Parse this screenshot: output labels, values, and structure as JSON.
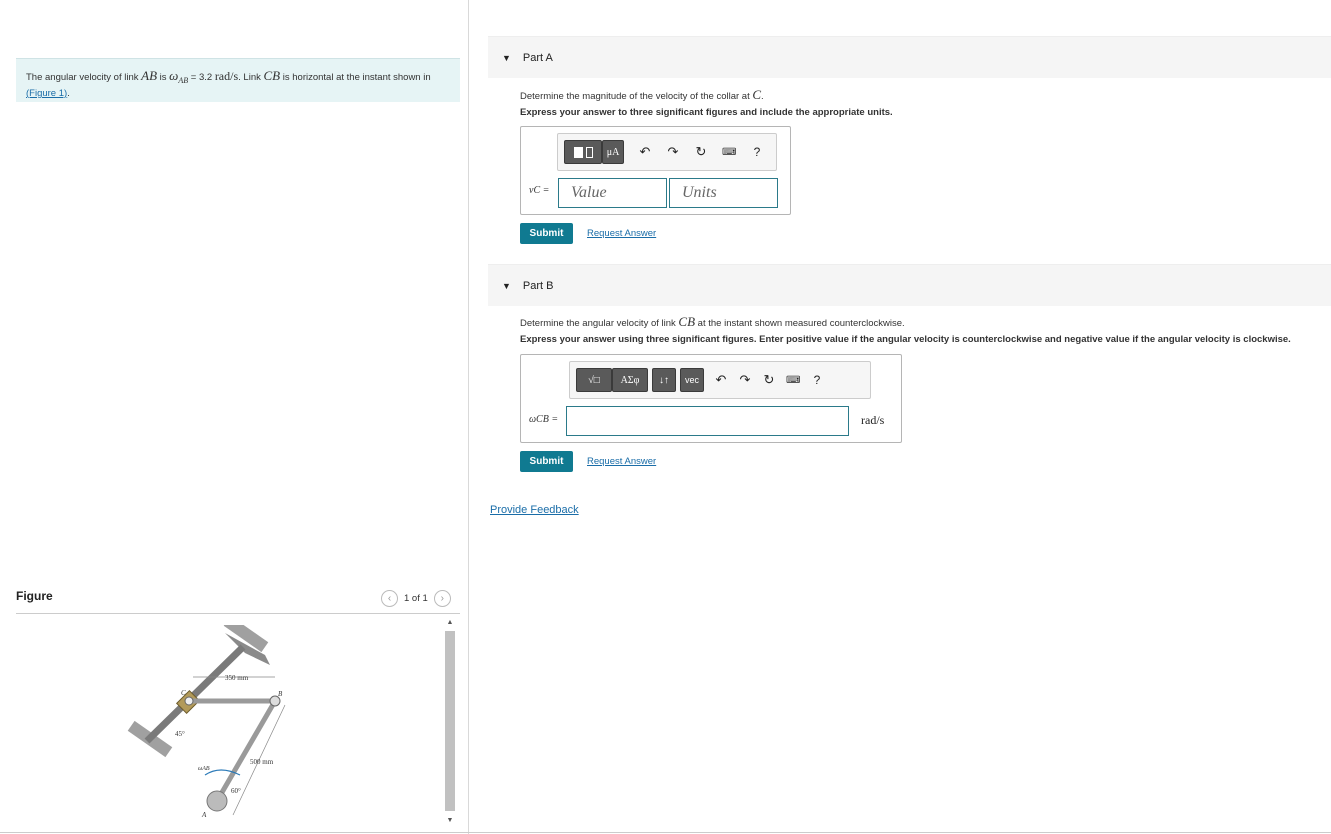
{
  "problem": {
    "text_1": "The angular velocity of link ",
    "AB": "AB",
    "text_2": " is ",
    "omega_ab": "ω",
    "omega_ab_sub": "AB",
    "text_3": " = 3.2 ",
    "rad_s": "rad/s",
    "text_4": ". Link ",
    "CB": "CB",
    "text_5": " is horizontal at the instant shown in",
    "figure_link": "(Figure 1)",
    "text_6": "."
  },
  "figure": {
    "title": "Figure",
    "pager_text": "1 of 1",
    "labels": {
      "dim_top": "350 mm",
      "dim_side": "500 mm",
      "angle_45": "45°",
      "angle_60": "60°",
      "omega": "ωAB",
      "C": "C",
      "B": "B",
      "A": "A"
    }
  },
  "part_a": {
    "header": "Part A",
    "question_1": "Determine the magnitude of the velocity of the collar at ",
    "question_var": "C",
    "question_2": ".",
    "instruction": "Express your answer to three significant figures and include the appropriate units.",
    "toolbar": {
      "mu_label": "μA",
      "help": "?"
    },
    "var_label": "vC =",
    "value_placeholder": "Value",
    "units_placeholder": "Units",
    "submit": "Submit",
    "request": "Request Answer"
  },
  "part_b": {
    "header": "Part B",
    "question_1": "Determine the angular velocity of link ",
    "question_var": "CB",
    "question_2": " at the instant shown measured counterclockwise.",
    "instruction": "Express your answer using three significant figures. Enter positive value if the angular velocity is counterclockwise and negative value if the angular velocity is clockwise.",
    "toolbar": {
      "sqrt_label": "√□",
      "greek_label": "ΑΣφ",
      "arrows_label": "↓↑",
      "vec_label": "vec",
      "help": "?"
    },
    "var_label": "ωCB =",
    "units": "rad/s",
    "submit": "Submit",
    "request": "Request Answer"
  },
  "feedback": "Provide Feedback"
}
